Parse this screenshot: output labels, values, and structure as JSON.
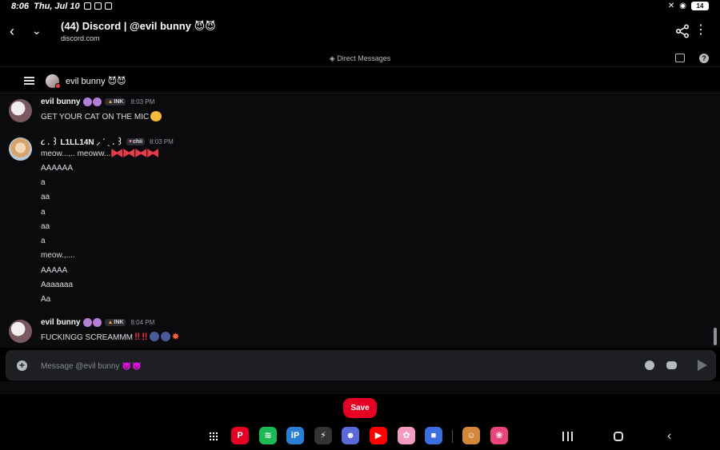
{
  "status_bar": {
    "time": "8:06",
    "date": "Thu, Jul 10",
    "battery": "14"
  },
  "browser": {
    "title": "(44) Discord | @evil bunny 😈😈",
    "domain": "discord.com"
  },
  "dm": {
    "section_label": "Direct Messages",
    "channel_name": "evil bunny 😈😈"
  },
  "messages": [
    {
      "author": "evil bunny",
      "tag": "INK",
      "time": "8:03 PM",
      "lines": [
        "GET YOUR CAT ON THE MIC"
      ]
    },
    {
      "author": "૮ . ꒱ L1LL14N ⸝ ˊ ˎ . ꒱",
      "tag": "chii",
      "time": "8:03 PM",
      "lines": [
        "meow...,.. meoww...",
        "AAAAAA",
        "a",
        "aa",
        "a",
        "aa",
        "a",
        "meow.,....",
        "AAAAA",
        "Aaaaaaa",
        "Aa"
      ]
    },
    {
      "author": "evil bunny",
      "tag": "INK",
      "time": "8:04 PM",
      "lines": [
        "FUCKINGG SCREAMMM"
      ]
    }
  ],
  "composer": {
    "placeholder": "Message @evil bunny 😈😈"
  },
  "save_label": "Save",
  "dock": {
    "apps": [
      {
        "name": "pinterest",
        "color": "#e60023",
        "glyph": "P"
      },
      {
        "name": "spotify",
        "color": "#1db954",
        "glyph": "≋"
      },
      {
        "name": "ibispaint",
        "color": "#2a7fd4",
        "glyph": "iP"
      },
      {
        "name": "bolt",
        "color": "#333333",
        "glyph": "⚡"
      },
      {
        "name": "gacha",
        "color": "#5a6ad8",
        "glyph": "☻"
      },
      {
        "name": "youtube-music",
        "color": "#ff0000",
        "glyph": "▶"
      },
      {
        "name": "anime-app",
        "color": "#f29ac0",
        "glyph": "✿"
      },
      {
        "name": "roblox",
        "color": "#3b6fe0",
        "glyph": "■"
      },
      {
        "name": "game-avatar",
        "color": "#d4873a",
        "glyph": "☺"
      },
      {
        "name": "gallery",
        "color": "#e8467a",
        "glyph": "❀"
      }
    ]
  }
}
